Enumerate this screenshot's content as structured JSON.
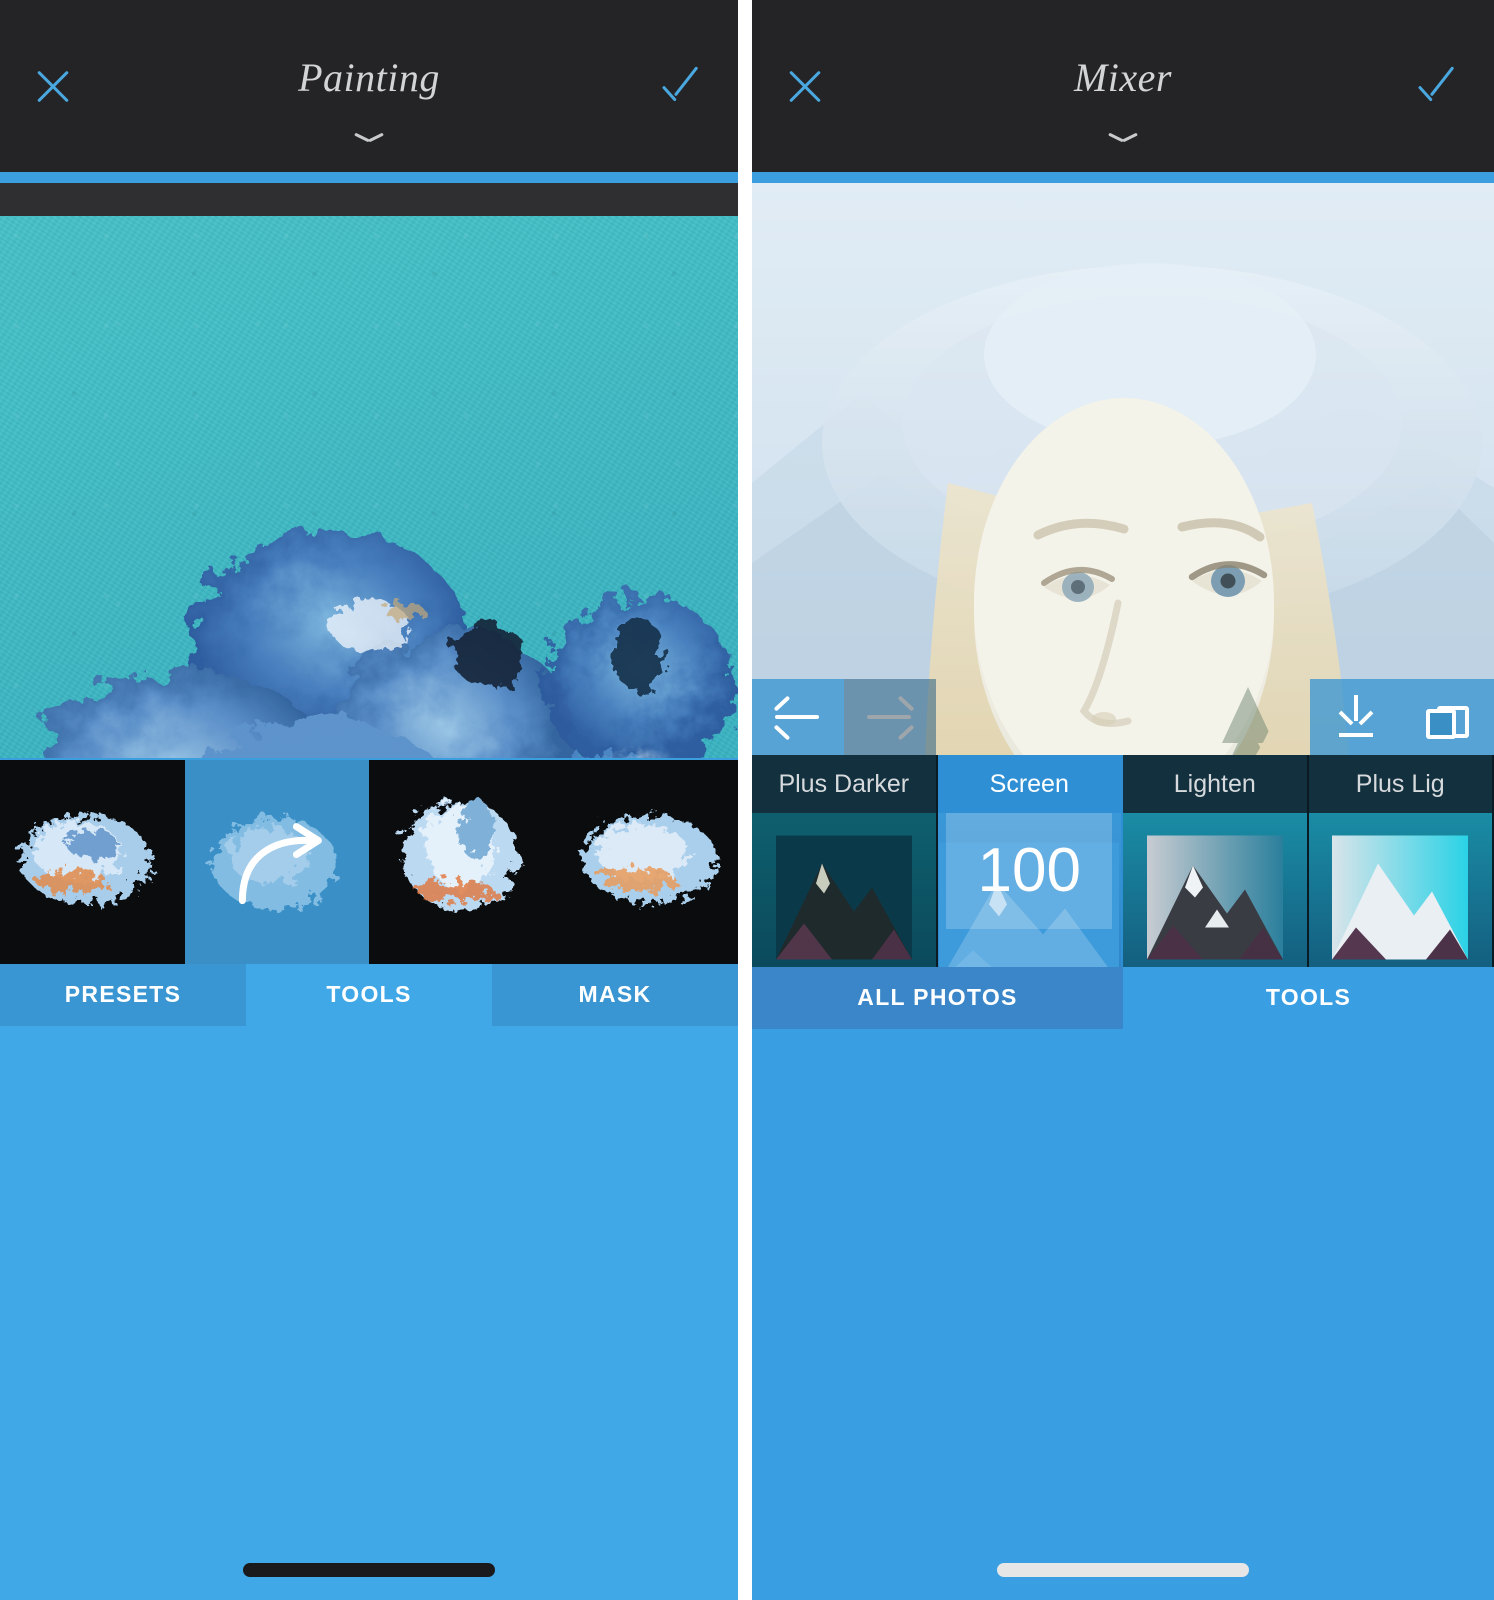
{
  "left_panel": {
    "header": {
      "close_icon": "close-x-icon",
      "title": "Painting",
      "confirm_icon": "checkmark-icon",
      "chevron_icon": "chevron-down-icon"
    },
    "toolbar": {
      "undo_icon": "arrow-left-icon",
      "redo_icon": "arrow-right-icon",
      "layers_icon": "layers-icon"
    },
    "brush_thumbnails": [
      {
        "name": "brush-preset-1",
        "selected": false
      },
      {
        "name": "brush-preset-2",
        "selected": true,
        "overlay_icon": "curved-arrow-icon"
      },
      {
        "name": "brush-preset-3",
        "selected": false
      },
      {
        "name": "brush-preset-4",
        "selected": false
      }
    ],
    "tabs": [
      {
        "label": "PRESETS",
        "active": false
      },
      {
        "label": "TOOLS",
        "active": true
      },
      {
        "label": "MASK",
        "active": false
      }
    ]
  },
  "right_panel": {
    "header": {
      "close_icon": "close-x-icon",
      "title": "Mixer",
      "confirm_icon": "checkmark-icon",
      "chevron_icon": "chevron-down-icon"
    },
    "toolbar": {
      "undo_icon": "arrow-left-icon",
      "redo_icon": "arrow-right-icon",
      "download_icon": "download-icon",
      "layers_icon": "layers-icon"
    },
    "blend_modes": [
      {
        "label": "Plus Darker",
        "selected": false,
        "value": null
      },
      {
        "label": "Screen",
        "selected": true,
        "value": "100"
      },
      {
        "label": "Lighten",
        "selected": false,
        "value": null
      },
      {
        "label": "Plus Lig",
        "selected": false,
        "value": null
      }
    ],
    "tabs": [
      {
        "label": "ALL PHOTOS",
        "active": false
      },
      {
        "label": "TOOLS",
        "active": true
      }
    ]
  },
  "colors": {
    "accent_blue": "#3b9ede",
    "tab_blue": "#3a96d3",
    "tab_blue_active": "#41a8e8",
    "header_dark": "#242427",
    "canvas_teal": "#3cb8c4",
    "blend_cell_dark": "#16303d",
    "blend_cell_selected": "#2f8fd4"
  }
}
